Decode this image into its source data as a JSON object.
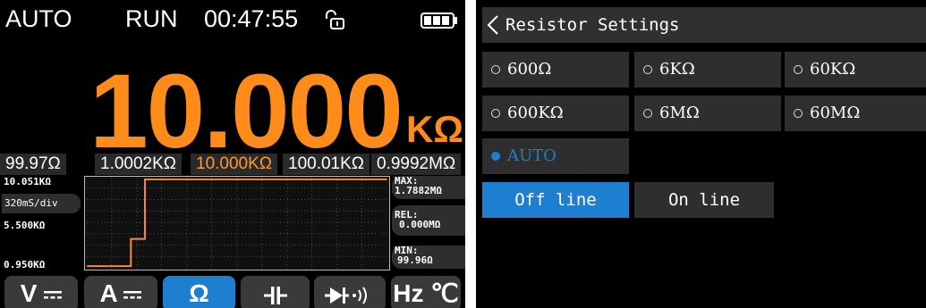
{
  "meter": {
    "status": {
      "mode": "AUTO",
      "state": "RUN",
      "time": "00:47:55"
    },
    "lock_icon": "unlock-icon",
    "battery_icon": "battery-icon",
    "reading": {
      "value": "10.000",
      "unit": "KΩ"
    },
    "ranges": [
      {
        "label": "99.97Ω",
        "active": false
      },
      {
        "label": "1.0002KΩ",
        "active": false
      },
      {
        "label": "10.000KΩ",
        "active": true
      },
      {
        "label": "100.01KΩ",
        "active": false
      },
      {
        "label": "0.9992MΩ",
        "active": false
      }
    ],
    "trend": {
      "y_top": "10.051KΩ",
      "y_mid": "5.500KΩ",
      "y_bottom": "0.950KΩ",
      "timebase": "320mS/div",
      "max_label": "MAX:",
      "max_value": "1.7882MΩ",
      "rel_label": "REL:",
      "rel_value": "0.000MΩ",
      "min_label": "MIN:",
      "min_value": "99.96Ω",
      "trace_color": "#ff8c1a"
    },
    "modes": [
      {
        "label": "V",
        "icon": "dc-symbol-icon",
        "active": false
      },
      {
        "label": "A",
        "icon": "dc-symbol-icon",
        "active": false
      },
      {
        "label": "Ω",
        "icon": "",
        "active": true
      },
      {
        "label": "",
        "icon": "capacitor-icon",
        "active": false
      },
      {
        "label": "",
        "icon": "diode-continuity-icon",
        "active": false
      },
      {
        "label": "Hz ℃",
        "icon": "",
        "active": false
      }
    ],
    "accent": "#ff8c1a"
  },
  "settings": {
    "title": "Resistor Settings",
    "back_icon": "chevron-left-icon",
    "options": [
      {
        "label": "600Ω",
        "selected": false
      },
      {
        "label": "6KΩ",
        "selected": false
      },
      {
        "label": "60KΩ",
        "selected": false
      },
      {
        "label": "600KΩ",
        "selected": false
      },
      {
        "label": "6MΩ",
        "selected": false
      },
      {
        "label": "60MΩ",
        "selected": false
      },
      {
        "label": "AUTO",
        "selected": true
      }
    ],
    "line_buttons": [
      {
        "label": "Off line",
        "active": true
      },
      {
        "label": "On line",
        "active": false
      }
    ],
    "accent": "#1e7fd0"
  }
}
